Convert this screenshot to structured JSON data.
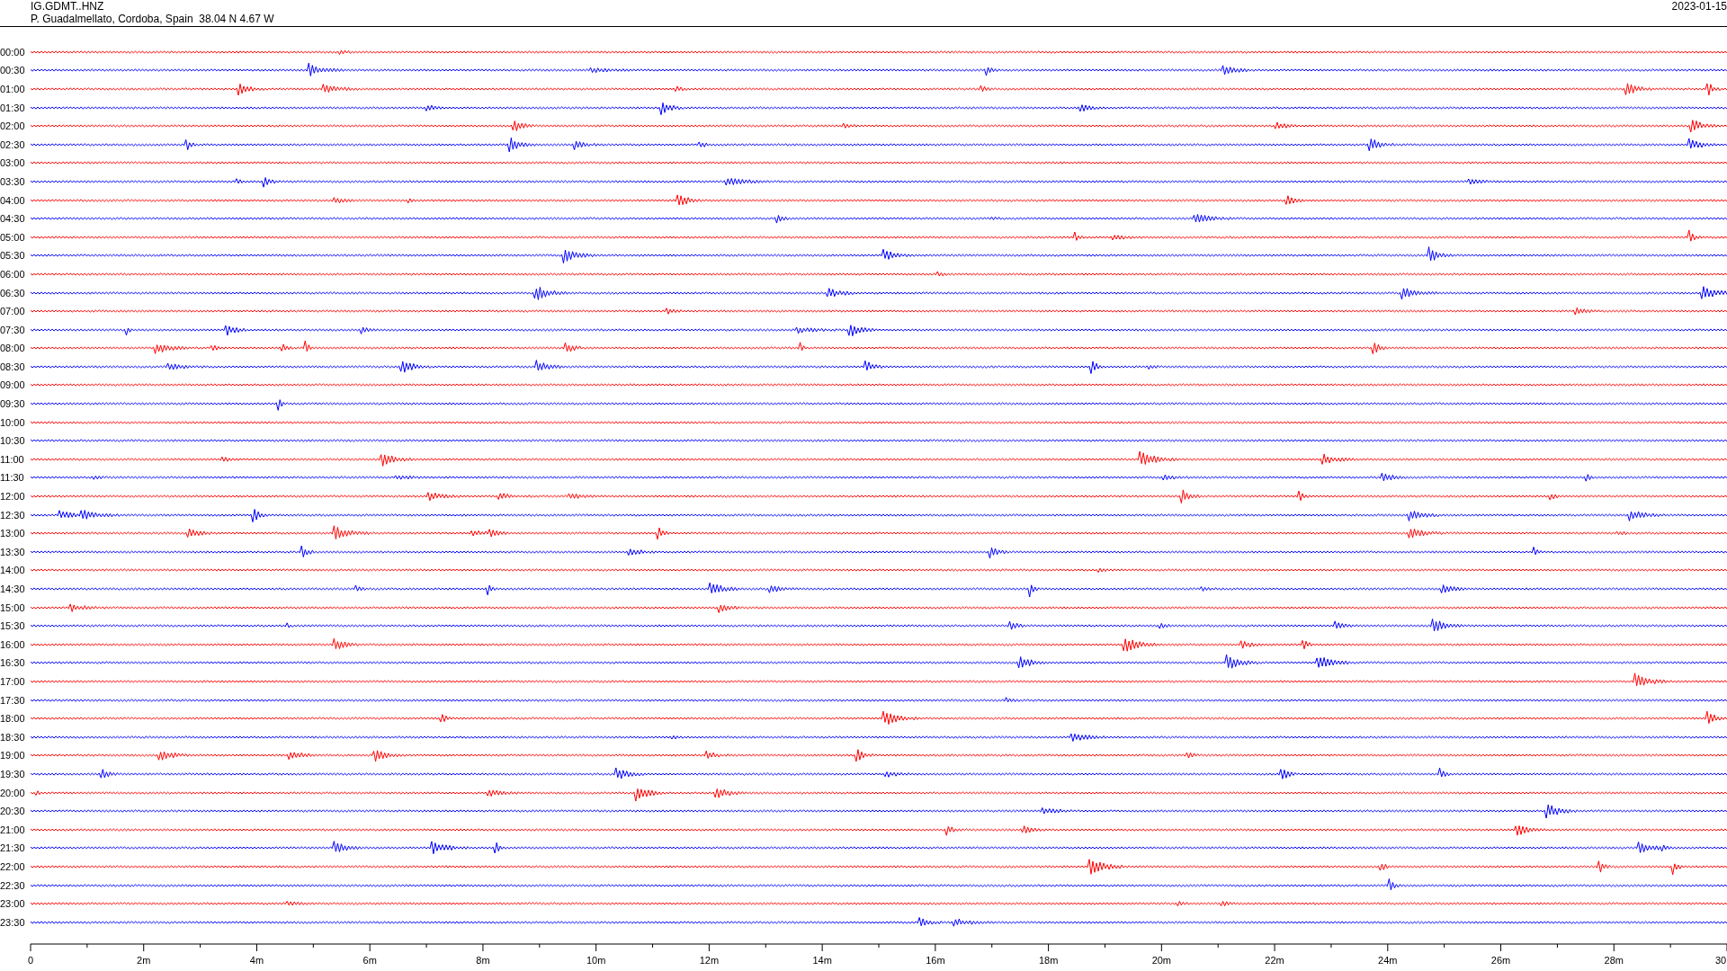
{
  "header": {
    "station": "IG.GDMT..HNZ",
    "location": "P. Guadalmellato, Cordoba, Spain  38.04 N 4.67 W",
    "date": "2023-01-15"
  },
  "traces": [
    {
      "time": "00:00",
      "color": "#ff0000"
    },
    {
      "time": "00:30",
      "color": "#0000ff"
    },
    {
      "time": "01:00",
      "color": "#ff0000"
    },
    {
      "time": "01:30",
      "color": "#0000ff"
    },
    {
      "time": "02:00",
      "color": "#ff0000"
    },
    {
      "time": "02:30",
      "color": "#0000ff"
    },
    {
      "time": "03:00",
      "color": "#ff0000"
    },
    {
      "time": "03:30",
      "color": "#0000ff"
    },
    {
      "time": "04:00",
      "color": "#ff0000"
    },
    {
      "time": "04:30",
      "color": "#0000ff"
    },
    {
      "time": "05:00",
      "color": "#ff0000"
    },
    {
      "time": "05:30",
      "color": "#0000ff"
    },
    {
      "time": "06:00",
      "color": "#ff0000"
    },
    {
      "time": "06:30",
      "color": "#0000ff"
    },
    {
      "time": "07:00",
      "color": "#ff0000"
    },
    {
      "time": "07:30",
      "color": "#0000ff"
    },
    {
      "time": "08:00",
      "color": "#ff0000"
    },
    {
      "time": "08:30",
      "color": "#0000ff"
    },
    {
      "time": "09:00",
      "color": "#ff0000"
    },
    {
      "time": "09:30",
      "color": "#0000ff"
    },
    {
      "time": "10:00",
      "color": "#ff0000"
    },
    {
      "time": "10:30",
      "color": "#0000ff"
    },
    {
      "time": "11:00",
      "color": "#ff0000"
    },
    {
      "time": "11:30",
      "color": "#0000ff"
    },
    {
      "time": "12:00",
      "color": "#ff0000"
    },
    {
      "time": "12:30",
      "color": "#0000ff"
    },
    {
      "time": "13:00",
      "color": "#ff0000"
    },
    {
      "time": "13:30",
      "color": "#0000ff"
    },
    {
      "time": "14:00",
      "color": "#ff0000"
    },
    {
      "time": "14:30",
      "color": "#0000ff"
    },
    {
      "time": "15:00",
      "color": "#ff0000"
    },
    {
      "time": "15:30",
      "color": "#0000ff"
    },
    {
      "time": "16:00",
      "color": "#ff0000"
    },
    {
      "time": "16:30",
      "color": "#0000ff"
    },
    {
      "time": "17:00",
      "color": "#ff0000"
    },
    {
      "time": "17:30",
      "color": "#0000ff"
    },
    {
      "time": "18:00",
      "color": "#ff0000"
    },
    {
      "time": "18:30",
      "color": "#0000ff"
    },
    {
      "time": "19:00",
      "color": "#ff0000"
    },
    {
      "time": "19:30",
      "color": "#0000ff"
    },
    {
      "time": "20:00",
      "color": "#ff0000"
    },
    {
      "time": "20:30",
      "color": "#0000ff"
    },
    {
      "time": "21:00",
      "color": "#ff0000"
    },
    {
      "time": "21:30",
      "color": "#0000ff"
    },
    {
      "time": "22:00",
      "color": "#ff0000"
    },
    {
      "time": "22:30",
      "color": "#0000ff"
    },
    {
      "time": "23:00",
      "color": "#ff0000"
    },
    {
      "time": "23:30",
      "color": "#0000ff"
    }
  ],
  "axis": {
    "labels": [
      "0",
      "2m",
      "4m",
      "6m",
      "8m",
      "10m",
      "12m",
      "14m",
      "16m",
      "18m",
      "20m",
      "22m",
      "24m",
      "26m",
      "28m",
      "30"
    ]
  }
}
